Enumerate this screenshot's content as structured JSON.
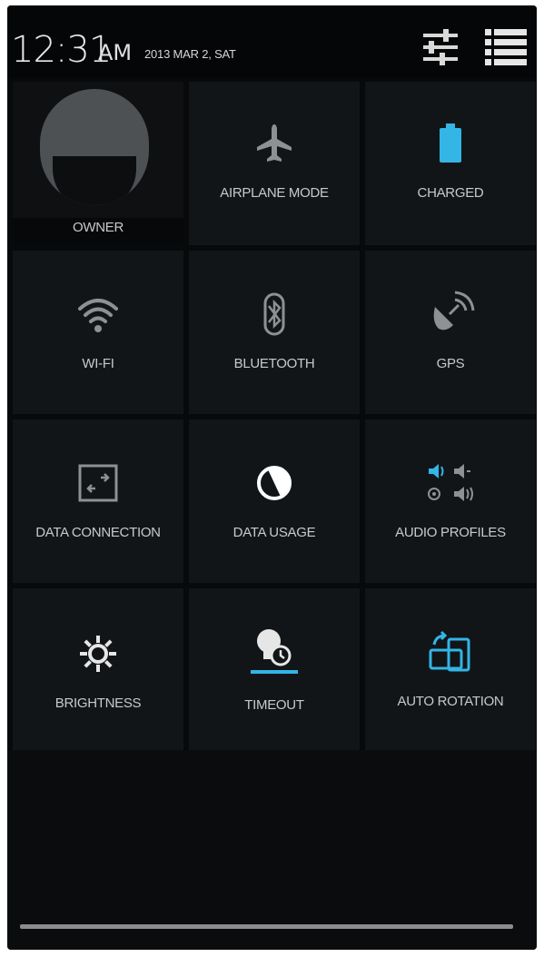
{
  "status_bar": {
    "time": "12:31",
    "ampm": "AM",
    "date": "2013 MAR 2, SAT",
    "icons": [
      "settings-sliders-icon",
      "list-menu-icon"
    ]
  },
  "tiles": [
    {
      "id": "owner",
      "label": "OWNER",
      "icon": "user-avatar-icon"
    },
    {
      "id": "airplane",
      "label": "AIRPLANE MODE",
      "icon": "airplane-icon"
    },
    {
      "id": "battery",
      "label": "CHARGED",
      "icon": "battery-icon"
    },
    {
      "id": "wifi",
      "label": "WI-FI",
      "icon": "wifi-icon"
    },
    {
      "id": "bluetooth",
      "label": "BLUETOOTH",
      "icon": "bluetooth-icon"
    },
    {
      "id": "gps",
      "label": "GPS",
      "icon": "gps-icon"
    },
    {
      "id": "data-connection",
      "label": "DATA CONNECTION",
      "icon": "data-connection-icon"
    },
    {
      "id": "data-usage",
      "label": "DATA USAGE",
      "icon": "data-usage-icon"
    },
    {
      "id": "audio-profiles",
      "label": "AUDIO PROFILES",
      "icon": "audio-profiles-icon"
    },
    {
      "id": "brightness",
      "label": "BRIGHTNESS",
      "icon": "brightness-icon"
    },
    {
      "id": "timeout",
      "label": "TIMEOUT",
      "icon": "timeout-icon"
    },
    {
      "id": "auto-rotation",
      "label": "AUTO ROTATION",
      "icon": "auto-rotation-icon"
    }
  ],
  "colors": {
    "accent": "#33b5e5",
    "icon_gray": "#8e9194",
    "label": "#c9c9c9",
    "tile_bg": "#121518",
    "panel_bg": "#0b0d0f"
  }
}
